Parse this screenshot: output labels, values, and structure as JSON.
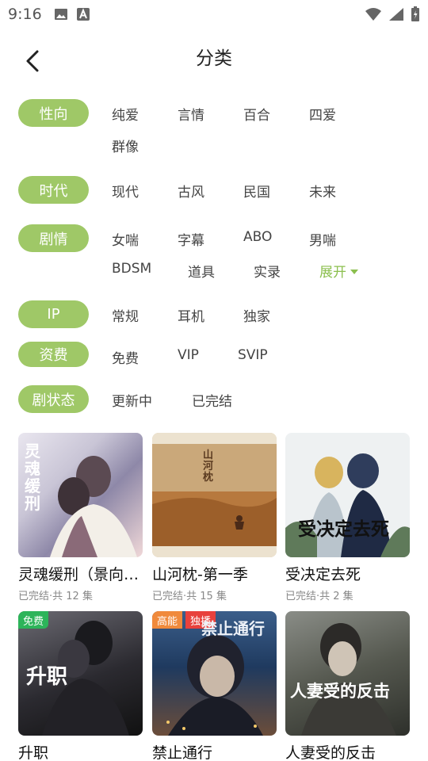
{
  "status": {
    "time": "9:16"
  },
  "header": {
    "title": "分类"
  },
  "filters": {
    "orientation": {
      "label": "性向",
      "options": [
        "纯爱",
        "言情",
        "百合",
        "四爱",
        "群像"
      ]
    },
    "era": {
      "label": "时代",
      "options": [
        "现代",
        "古风",
        "民国",
        "未来"
      ]
    },
    "plot": {
      "label": "剧情",
      "options": [
        "女喘",
        "字幕",
        "ABO",
        "男喘",
        "BDSM",
        "道具",
        "实录"
      ],
      "expand": "展开"
    },
    "ip": {
      "label": "IP",
      "options": [
        "常规",
        "耳机",
        "独家"
      ]
    },
    "fee": {
      "label": "资费",
      "options": [
        "免费",
        "VIP",
        "SVIP"
      ]
    },
    "state": {
      "label": "剧状态",
      "options": [
        "更新中",
        "已完结"
      ]
    }
  },
  "cards": [
    {
      "title": "灵魂缓刑（景向…",
      "sub": "已完结·共 12 集",
      "cover_text": "灵魂缓刑"
    },
    {
      "title": "山河枕-第一季",
      "sub": "已完结·共 15 集",
      "cover_text": "山河枕"
    },
    {
      "title": "受决定去死",
      "sub": "已完结·共 2 集",
      "cover_text": "受决定去死"
    },
    {
      "title": "升职",
      "badges": [
        "免费"
      ],
      "cover_text": "升职"
    },
    {
      "title": "禁止通行",
      "badges": [
        "高能",
        "独播"
      ],
      "cover_text": "禁止通行"
    },
    {
      "title": "人妻受的反击",
      "cover_text": "人妻受的反击"
    }
  ],
  "colors": {
    "accent": "#9fc867",
    "badge_free": "#2db45a",
    "badge_high": "#f08a3c",
    "badge_exclusive": "#e8413c"
  }
}
